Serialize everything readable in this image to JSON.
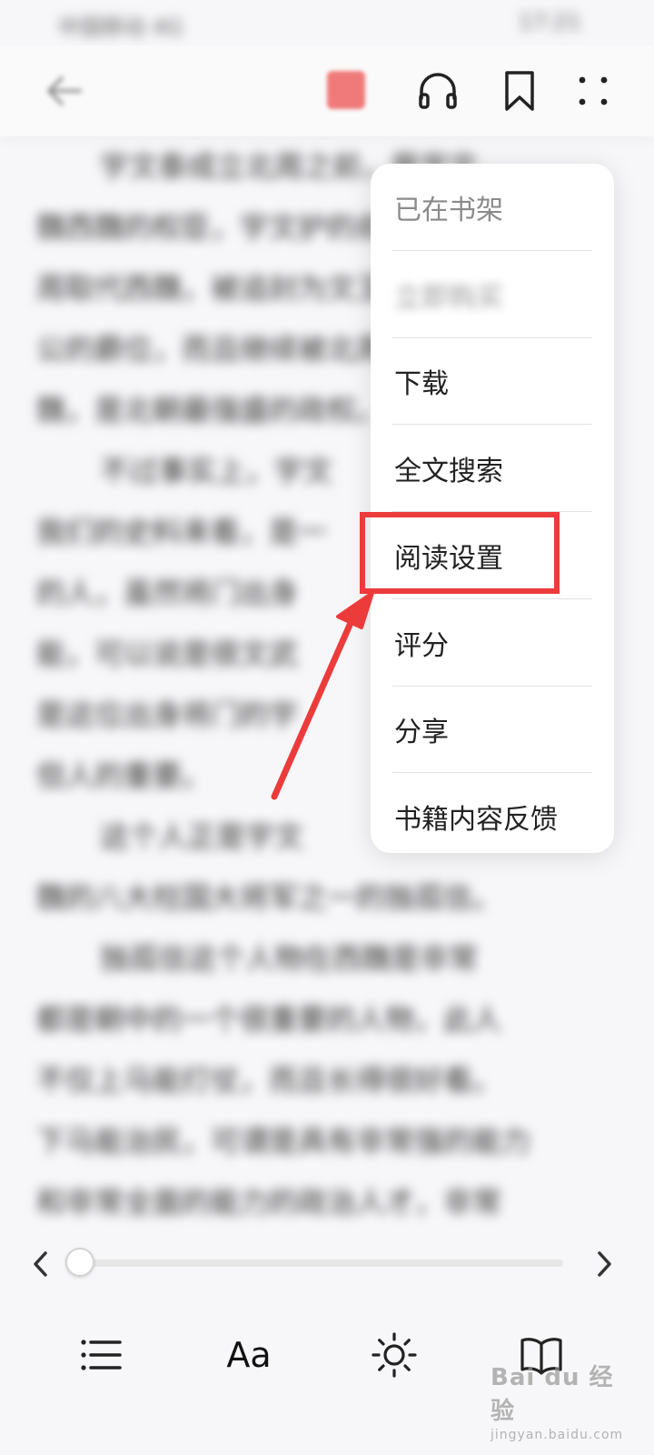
{
  "status_bar": {
    "left_text": "中国移动 4G",
    "right_text": "17:21"
  },
  "toolbar": {
    "back_icon": "arrow-left-icon",
    "badge_icon": "red-badge-icon",
    "listen_icon": "headphones-icon",
    "bookmark_icon": "bookmark-icon",
    "more_icon": "more-dots-icon"
  },
  "background_text": {
    "note": "",
    "lines": [
      "宇文泰成立北周之前，是宇文",
      "魏西魏的权臣，宇文护的叔父",
      "周取代西魏，被追封为文王",
      "公的爵位，而且继续被北周",
      "魏，是北朝最强盛的政权。",
      "不过事实上，宇文",
      "我们的史料来看，是一",
      "的人，虽然将门出身",
      "能，可以说是很文武",
      "是这位出身将门的宇",
      "但人的重要。",
      "这个人正是宇文",
      "魏的八大柱国大将军之一的独孤信。",
      "独孤信这个人物在西魏是非常",
      "都是朝中的一个很重要的人物，此人",
      "不仅上马能打仗，而且长得很好看。",
      "下马能治民，可谓是具有非常强的能力",
      "和非常全面的能力的政治人才，非常"
    ]
  },
  "menu": {
    "items": [
      {
        "label": "已在书架",
        "state": "disabled"
      },
      {
        "label": "立即购买",
        "state": "blurred"
      },
      {
        "label": "下载",
        "state": "normal"
      },
      {
        "label": "全文搜索",
        "state": "normal"
      },
      {
        "label": "阅读设置",
        "state": "highlighted"
      },
      {
        "label": "评分",
        "state": "normal"
      },
      {
        "label": "分享",
        "state": "normal"
      },
      {
        "label": "书籍内容反馈",
        "state": "normal"
      }
    ]
  },
  "annotation": {
    "color": "#ec3b3b",
    "target": "阅读设置"
  },
  "progress": {
    "value": 0.0,
    "prev_icon": "chevron-left-icon",
    "next_icon": "chevron-right-icon"
  },
  "bottom_bar": {
    "toc_icon": "list-icon",
    "font_label": "Aa",
    "brightness_icon": "sun-icon",
    "book_icon": "open-book-icon"
  },
  "watermark": {
    "main": "Bai du 经验",
    "sub": "jingyan.baidu.com"
  }
}
